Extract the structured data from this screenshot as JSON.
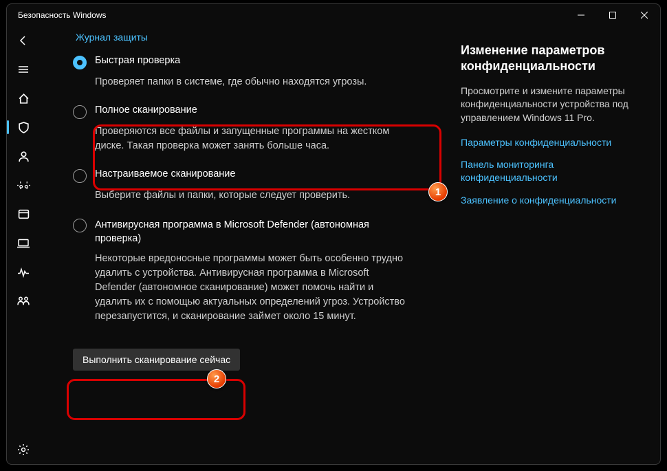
{
  "window": {
    "title": "Безопасность Windows"
  },
  "top_link": "Журнал защиты",
  "options": {
    "quick": {
      "title": "Быстрая проверка",
      "desc": "Проверяет папки в системе, где обычно находятся угрозы."
    },
    "full": {
      "title": "Полное сканирование",
      "desc": "Проверяются все файлы и запущенные программы на жестком диске. Такая проверка может занять больше часа."
    },
    "custom": {
      "title": "Настраиваемое сканирование",
      "desc": "Выберите файлы и папки, которые следует проверить."
    },
    "offline": {
      "title": "Антивирусная программа в Microsoft Defender (автономная проверка)",
      "desc": "Некоторые вредоносные программы может быть особенно трудно удалить с устройства. Антивирусная программа в Microsoft Defender (автономное сканирование) может помочь найти и удалить их с помощью актуальных определений угроз. Устройство перезапустится, и сканирование займет около 15 минут."
    }
  },
  "scan_button": "Выполнить сканирование сейчас",
  "side_panel": {
    "title": "Изменение параметров конфиденциальности",
    "desc": "Просмотрите и измените параметры конфиденциальности устройства под управлением Windows 11 Pro.",
    "links": {
      "l1": "Параметры конфиденциальности",
      "l2": "Панель мониторинга конфиденциальности",
      "l3": "Заявление о конфиденциальности"
    }
  },
  "badges": {
    "b1": "1",
    "b2": "2"
  }
}
